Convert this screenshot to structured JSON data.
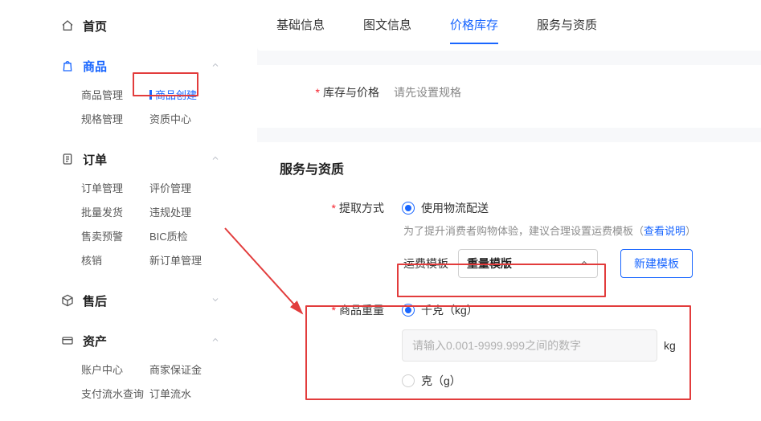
{
  "sidebar": {
    "home": {
      "label": "首页"
    },
    "goods": {
      "label": "商品",
      "items": [
        {
          "label": "商品管理"
        },
        {
          "label": "商品创建"
        },
        {
          "label": "规格管理"
        },
        {
          "label": "资质中心"
        }
      ]
    },
    "order": {
      "label": "订单",
      "items": [
        {
          "label": "订单管理"
        },
        {
          "label": "评价管理"
        },
        {
          "label": "批量发货"
        },
        {
          "label": "违规处理"
        },
        {
          "label": "售卖预警"
        },
        {
          "label": "BIC质检"
        },
        {
          "label": "核销"
        },
        {
          "label": "新订单管理"
        }
      ]
    },
    "after": {
      "label": "售后"
    },
    "asset": {
      "label": "资产",
      "items": [
        {
          "label": "账户中心"
        },
        {
          "label": "商家保证金"
        },
        {
          "label": "支付流水查询"
        },
        {
          "label": "订单流水"
        }
      ]
    }
  },
  "tabs": [
    {
      "label": "基础信息"
    },
    {
      "label": "图文信息"
    },
    {
      "label": "价格库存"
    },
    {
      "label": "服务与资质"
    }
  ],
  "stock": {
    "label": "库存与价格",
    "hint": "请先设置规格"
  },
  "service": {
    "title": "服务与资质",
    "pickup_label": "提取方式",
    "pickup_option": "使用物流配送",
    "tip_prefix": "为了提升消费者购物体验，建议合理设置运费模板（",
    "tip_link": "查看说明",
    "tip_suffix": "）",
    "template_label": "运费模板",
    "template_value": "重量模版",
    "new_template_btn": "新建模板",
    "weight_label": "商品重量",
    "weight_kg": "千克（kg）",
    "weight_g": "克（g）",
    "weight_placeholder": "请输入0.001-9999.999之间的数字",
    "weight_unit": "kg"
  }
}
